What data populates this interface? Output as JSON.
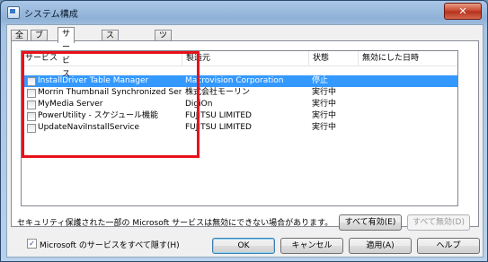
{
  "window": {
    "title": "システム構成",
    "close_label": "✕"
  },
  "tabs": [
    {
      "label": "全般"
    },
    {
      "label": "ブート"
    },
    {
      "label": "サービス",
      "active": true
    },
    {
      "label": "スタートアップ"
    },
    {
      "label": "ツール"
    }
  ],
  "columns": [
    "サービス",
    "製造元",
    "状態",
    "無効にした日時"
  ],
  "services": [
    {
      "name": "InstallDriver Table Manager",
      "maker": "Macrovision Corporation",
      "status": "停止",
      "date": "",
      "checked": false,
      "selected": true
    },
    {
      "name": "Morrin Thumbnail Synchronized Servic...",
      "maker": "株式会社モーリン",
      "status": "実行中",
      "date": "",
      "checked": false,
      "selected": false
    },
    {
      "name": "MyMedia Server",
      "maker": "DigiOn",
      "status": "実行中",
      "date": "",
      "checked": false,
      "selected": false
    },
    {
      "name": "PowerUtility - スケジュール機能",
      "maker": "FUJITSU LIMITED",
      "status": "実行中",
      "date": "",
      "checked": false,
      "selected": false
    },
    {
      "name": "UpdateNaviInstallService",
      "maker": "FUJITSU LIMITED",
      "status": "実行中",
      "date": "",
      "checked": false,
      "selected": false
    }
  ],
  "note": "セキュリティ保護された一部の Microsoft サービスは無効にできない場合があります。",
  "buttons": {
    "enable_all": "すべて有効(E)",
    "disable_all": "すべて無効(D)",
    "ok": "OK",
    "cancel": "キャンセル",
    "apply": "適用(A)",
    "help": "ヘルプ"
  },
  "hide_ms": {
    "label": "Microsoft のサービスをすべて隠す(H)",
    "checked": true
  },
  "colors": {
    "highlight": "#3399ff",
    "annotation_box": "#e8111b"
  }
}
